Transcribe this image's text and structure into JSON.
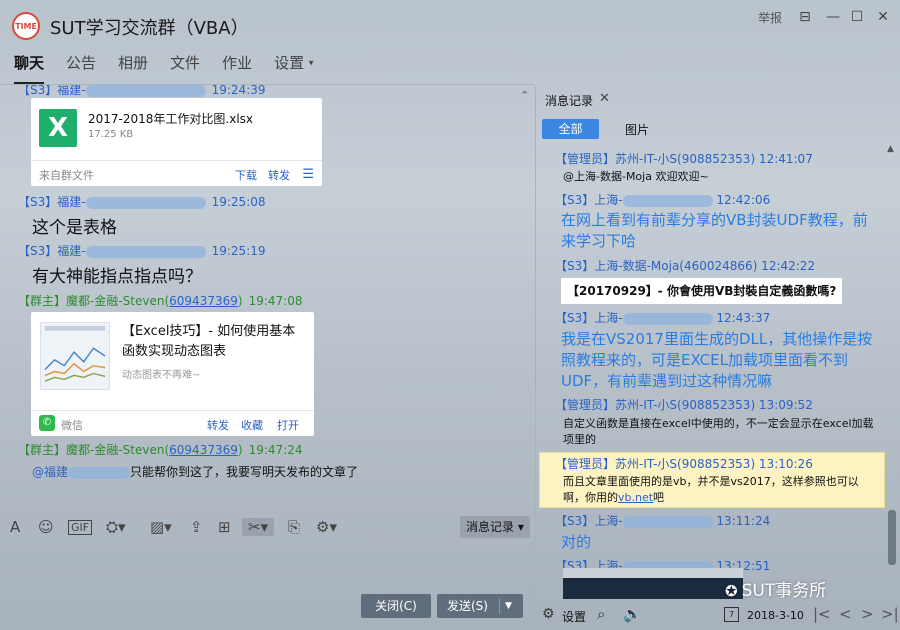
{
  "window": {
    "title": "SUT学习交流群（VBA）",
    "logo_text": "TIME",
    "report_label": "举报",
    "controls": [
      "minimize-icon",
      "maximize-icon",
      "close-icon"
    ]
  },
  "tabs": [
    {
      "label": "聊天",
      "active": true
    },
    {
      "label": "公告"
    },
    {
      "label": "相册"
    },
    {
      "label": "文件"
    },
    {
      "label": "作业"
    },
    {
      "label": "设置",
      "has_dropdown": true
    }
  ],
  "chat": {
    "messages": [
      {
        "role": "【S3】",
        "name": "福建-",
        "time": "19:24:39"
      },
      {
        "file": {
          "name": "2017-2018年工作对比图.xlsx",
          "size": "17.25 KB",
          "source": "来自群文件",
          "download": "下载",
          "forward": "转发"
        }
      },
      {
        "role": "【S3】",
        "name": "福建-",
        "time": "19:25:08",
        "text": "这个是表格"
      },
      {
        "role": "【S3】",
        "name": "福建-",
        "time": "19:25:19",
        "text": "有大神能指点指点吗？"
      },
      {
        "role": "【群主】",
        "name": "魔都-金融-Steven(",
        "qq": "609437369",
        "close": ")",
        "time": "19:47:08"
      },
      {
        "article": {
          "title": "【Excel技巧】- 如何使用基本函数实现动态图表",
          "subtitle": "动态图表不再难~",
          "source": "微信",
          "forward": "转发",
          "favorite": "收藏",
          "open": "打开"
        }
      },
      {
        "role": "【群主】",
        "name": "魔都-金融-Steven(",
        "qq": "609437369",
        "close": ")",
        "time": "19:47:24"
      },
      {
        "mention": "@福建",
        "text": "只能帮你到这了，我要写明天发布的文章了"
      }
    ]
  },
  "toolbar": {
    "history_button": "消息记录",
    "close_button": "关闭(C)",
    "send_button": "发送(S)"
  },
  "history_panel": {
    "tab_label": "消息记录",
    "filter_all": "全部",
    "filter_pictures": "图片",
    "entries": [
      {
        "sender": "【管理员】苏州-IT-小S(908852353) 12:41:07",
        "text": "@上海-数据-Moja 欢迎欢迎~"
      },
      {
        "sender_prefix": "【S3】上海-",
        "time": "12:42:06",
        "text": "在网上看到有前辈分享的VB封装UDF教程，前来学习下哈"
      },
      {
        "sender": "【S3】上海-数据-Moja(460024866) 12:42:22",
        "notice": "【20170929】- 你會使用VB封裝自定義函數嗎?"
      },
      {
        "sender_prefix": "【S3】上海-",
        "time": "12:43:37",
        "text": "我是在VS2017里面生成的DLL，其他操作是按照教程来的，可是EXCEL加载项里面看不到UDF，有前辈遇到过这种情况嘛"
      },
      {
        "sender": "【管理员】苏州-IT-小S(908852353) 13:09:52",
        "text": "自定义函数是直接在excel中使用的，不一定会显示在excel加载项里的"
      },
      {
        "sender": "【管理员】苏州-IT-小S(908852353) 13:10:26",
        "text_before_link": "而且文章里面使用的是vb，并不是vs2017，这样参照也可以啊，你用的",
        "link": "vb.net",
        "text_after_link": "吧"
      },
      {
        "sender_prefix": "【S3】上海-",
        "time": "13:11:24",
        "text": "对的"
      },
      {
        "sender_prefix": "【S3】上海-",
        "time": "13:12:51"
      }
    ],
    "footer": {
      "settings": "设置",
      "date": "2018-3-10",
      "calendar_day": "7"
    }
  },
  "watermark": "SUT事务所",
  "colors": {
    "accent_blue": "#2a7de0",
    "owner_green": "#2f8a2f",
    "highlight": "#fdf2c2",
    "excel_green": "#1fae6b",
    "wechat_green": "#2fb84d"
  }
}
